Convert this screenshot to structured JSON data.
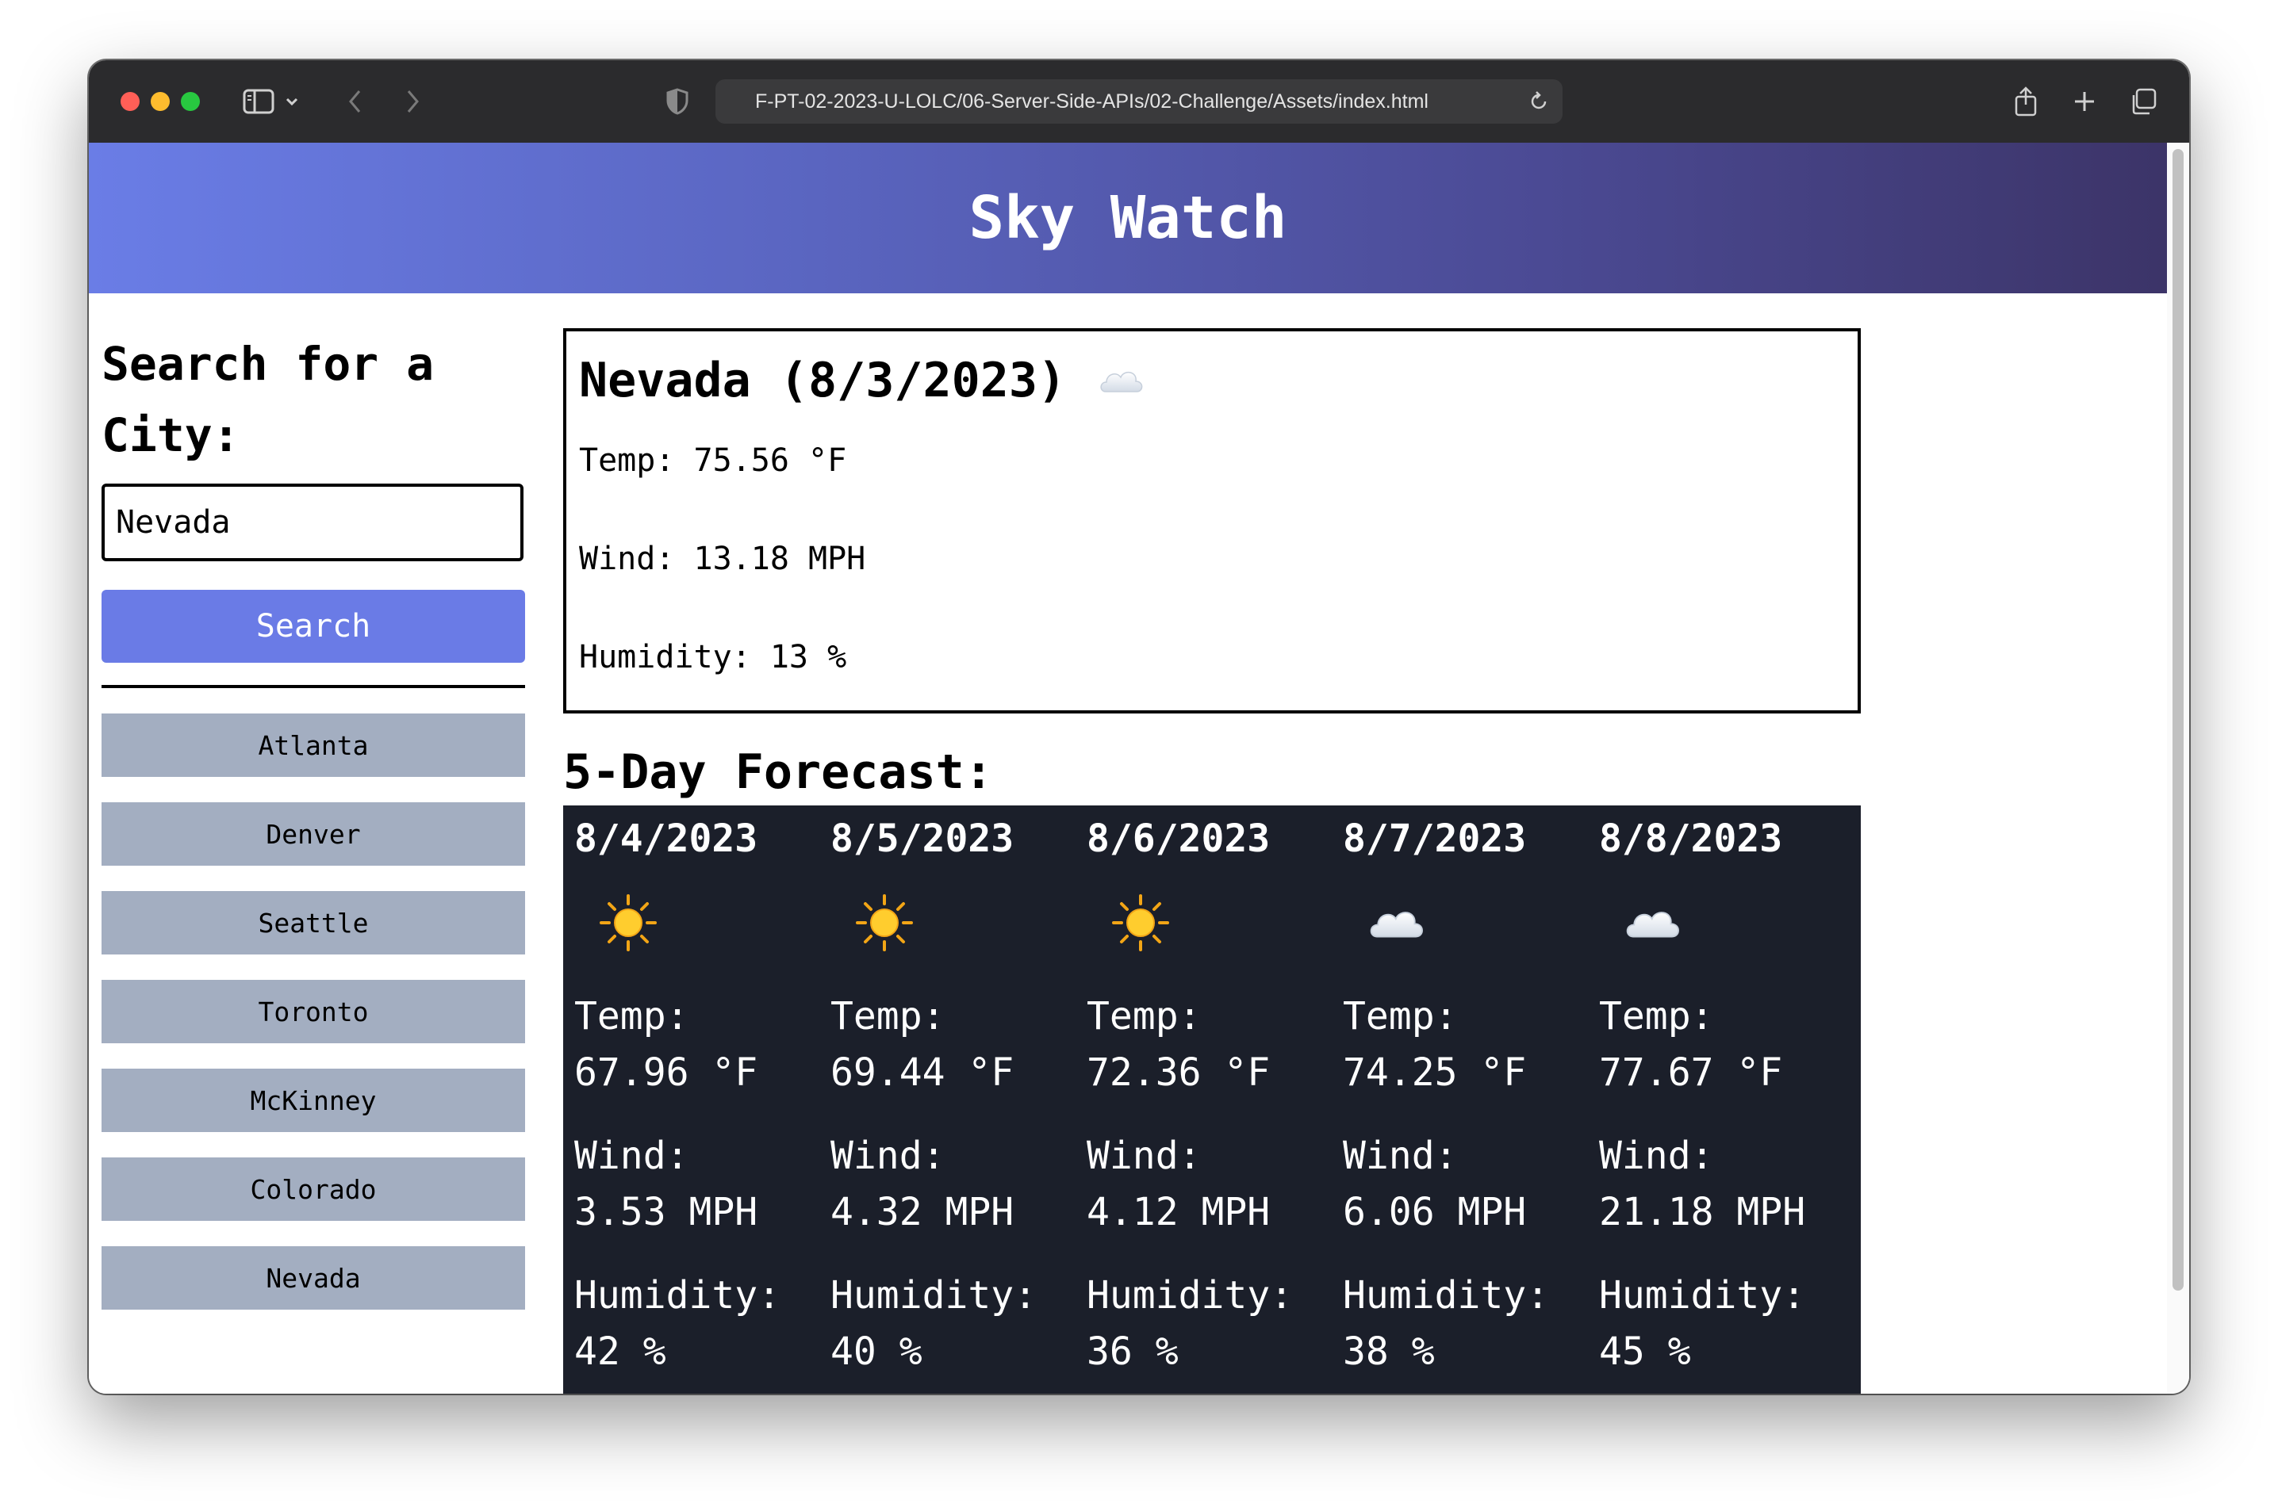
{
  "browser": {
    "url": "F-PT-02-2023-U-LOLC/06-Server-Side-APIs/02-Challenge/Assets/index.html",
    "traffic_lights": [
      "#ff5f57",
      "#febc2e",
      "#28c840"
    ]
  },
  "header": {
    "title": "Sky Watch"
  },
  "sidebar": {
    "title": "Search for a City:",
    "input_value": "Nevada",
    "search_label": "Search",
    "history": [
      "Atlanta",
      "Denver",
      "Seattle",
      "Toronto",
      "McKinney",
      "Colorado",
      "Nevada"
    ]
  },
  "current": {
    "heading": "Nevada (8/3/2023)",
    "icon": "cloud-icon",
    "temp": "Temp: 75.56 °F",
    "wind": "Wind: 13.18 MPH",
    "humidity": "Humidity: 13 %"
  },
  "forecast": {
    "title": "5-Day Forecast:",
    "days": [
      {
        "date": "8/4/2023",
        "icon": "sun-icon",
        "temp_label": "Temp:",
        "temp": "67.96 °F",
        "wind_label": "Wind:",
        "wind": "3.53 MPH",
        "humidity_label": "Humidity:",
        "humidity": "42 %"
      },
      {
        "date": "8/5/2023",
        "icon": "sun-icon",
        "temp_label": "Temp:",
        "temp": "69.44 °F",
        "wind_label": "Wind:",
        "wind": "4.32 MPH",
        "humidity_label": "Humidity:",
        "humidity": "40 %"
      },
      {
        "date": "8/6/2023",
        "icon": "sun-icon",
        "temp_label": "Temp:",
        "temp": "72.36 °F",
        "wind_label": "Wind:",
        "wind": "4.12 MPH",
        "humidity_label": "Humidity:",
        "humidity": "36 %"
      },
      {
        "date": "8/7/2023",
        "icon": "cloud-icon",
        "temp_label": "Temp:",
        "temp": "74.25 °F",
        "wind_label": "Wind:",
        "wind": "6.06 MPH",
        "humidity_label": "Humidity:",
        "humidity": "38 %"
      },
      {
        "date": "8/8/2023",
        "icon": "cloud-icon",
        "temp_label": "Temp:",
        "temp": "77.67 °F",
        "wind_label": "Wind:",
        "wind": "21.18 MPH",
        "humidity_label": "Humidity:",
        "humidity": "45 %"
      }
    ]
  }
}
